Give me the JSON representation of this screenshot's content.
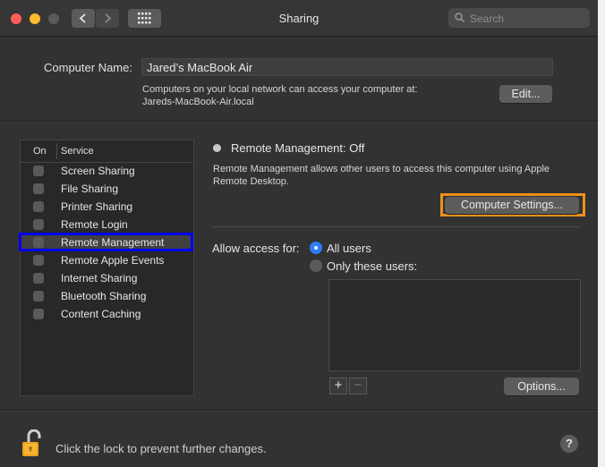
{
  "window": {
    "title": "Sharing"
  },
  "search": {
    "placeholder": "Search"
  },
  "computer_name": {
    "label": "Computer Name:",
    "value": "Jared’s MacBook Air",
    "info_line1": "Computers on your local network can access your computer at:",
    "info_line2": "Jareds-MacBook-Air.local",
    "edit_label": "Edit..."
  },
  "services": {
    "header_on": "On",
    "header_service": "Service",
    "items": [
      {
        "label": "Screen Sharing",
        "checked": false
      },
      {
        "label": "File Sharing",
        "checked": false
      },
      {
        "label": "Printer Sharing",
        "checked": false
      },
      {
        "label": "Remote Login",
        "checked": false
      },
      {
        "label": "Remote Management",
        "checked": false
      },
      {
        "label": "Remote Apple Events",
        "checked": false
      },
      {
        "label": "Internet Sharing",
        "checked": false
      },
      {
        "label": "Bluetooth Sharing",
        "checked": false
      },
      {
        "label": "Content Caching",
        "checked": false
      }
    ],
    "selected": "Remote Management"
  },
  "detail": {
    "status": "Remote Management: Off",
    "description_line1": "Remote Management allows other users to access this computer using Apple",
    "description_line2": "Remote Desktop.",
    "computer_settings_label": "Computer Settings...",
    "allow_access_label": "Allow access for:",
    "option_all_users": "All users",
    "option_only_these": "Only these users:",
    "selected_option": "All users",
    "add_label": "+",
    "remove_label": "−",
    "options_label": "Options..."
  },
  "footer": {
    "lock_text": "Click the lock to prevent further changes.",
    "help_label": "?"
  },
  "colors": {
    "highlight_outline": "#0000f0",
    "button_outline": "#f0901a",
    "radio_selected": "#2f7df6"
  }
}
